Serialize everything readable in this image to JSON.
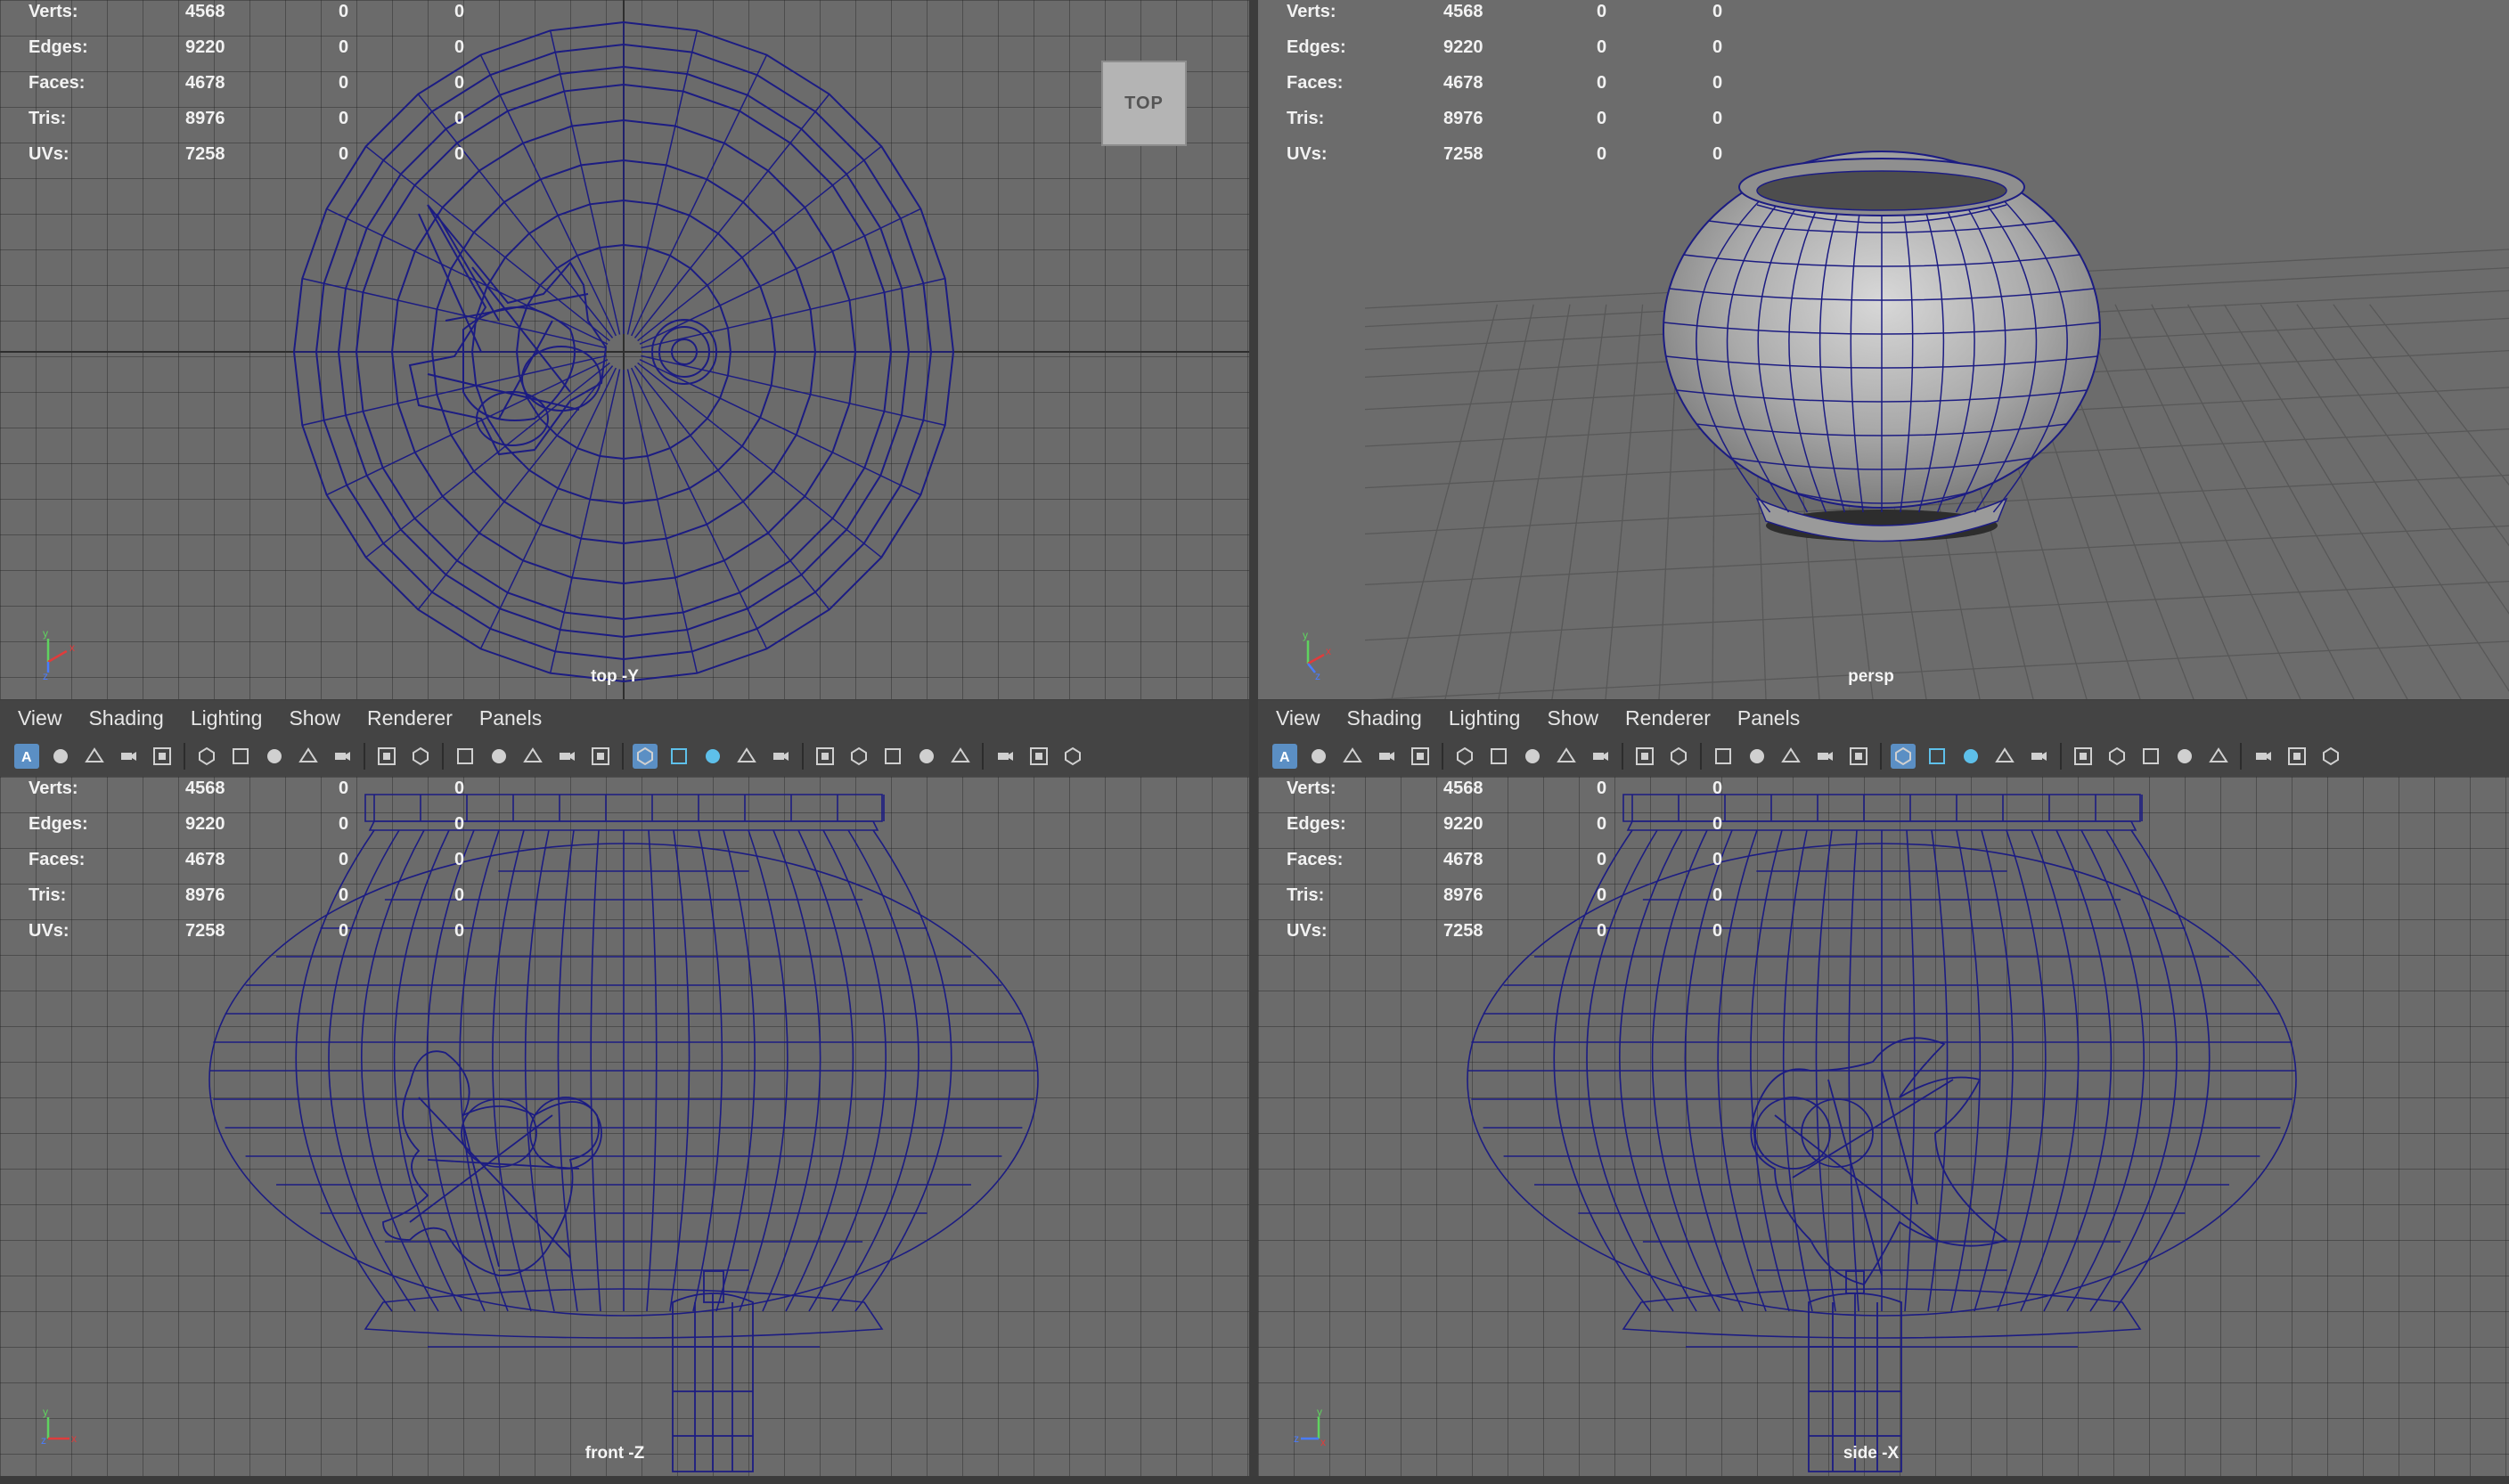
{
  "stats": [
    {
      "label": "Verts:",
      "v1": "4568",
      "v2": "0",
      "v3": "0"
    },
    {
      "label": "Edges:",
      "v1": "9220",
      "v2": "0",
      "v3": "0"
    },
    {
      "label": "Faces:",
      "v1": "4678",
      "v2": "0",
      "v3": "0"
    },
    {
      "label": "Tris:",
      "v1": "8976",
      "v2": "0",
      "v3": "0"
    },
    {
      "label": "UVs:",
      "v1": "7258",
      "v2": "0",
      "v3": "0"
    }
  ],
  "viewports": {
    "top": {
      "camera": "top -Y"
    },
    "persp": {
      "camera": "persp"
    },
    "front": {
      "camera": "front -Z"
    },
    "side": {
      "camera": "side -X"
    }
  },
  "viewcube": {
    "label": "TOP"
  },
  "menu": [
    "View",
    "Shading",
    "Lighting",
    "Show",
    "Renderer",
    "Panels"
  ],
  "toolbar_icons": [
    "select-mode-icon",
    "frame-all-icon",
    "grid-icon",
    "shade-icon",
    "texture-icon",
    "camera-icon",
    "camera-tumble-icon",
    "camera-track-icon",
    "bookmark-icon",
    "image-plane-icon",
    "move-icon",
    "paint-icon",
    "grid-toggle-icon",
    "film-gate-icon",
    "resolution-gate-icon",
    "safe-area-icon",
    "field-chart-icon",
    "wireframe-icon",
    "smooth-shade-icon",
    "default-material-icon",
    "xray-icon",
    "lights-icon",
    "shadows-icon",
    "screen-space-ao-icon",
    "motion-blur-icon",
    "anti-alias-icon",
    "depth-of-field-icon",
    "isolate-select-icon",
    "xray-joints-icon",
    "layout-icon"
  ],
  "colors": {
    "viewport_bg": "#6b6b6b",
    "wireframe": "#1c1c82",
    "panel_bg": "#444444",
    "active_icon": "#5b8fc4"
  }
}
